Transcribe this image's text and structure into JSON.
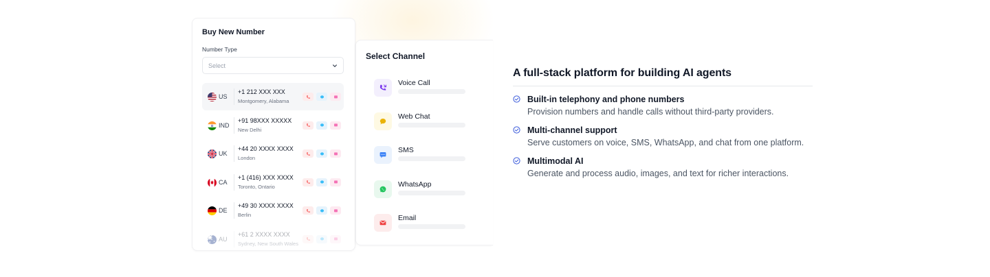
{
  "buy_card": {
    "title": "Buy New Number",
    "number_type_label": "Number Type",
    "select_placeholder": "Select",
    "numbers": [
      {
        "code": "US",
        "number": "+1 212 XXX XXX",
        "location": "Montgomery, Alabama",
        "flag": "us-flag-icon"
      },
      {
        "code": "IND",
        "number": "+91 98XXX XXXXX",
        "location": "New Delhi",
        "flag": "india-flag-icon"
      },
      {
        "code": "UK",
        "number": "+44 20 XXXX XXXX",
        "location": "London",
        "flag": "uk-flag-icon"
      },
      {
        "code": "CA",
        "number": "+1 (416) XXX XXXX",
        "location": "Toronto, Ontario",
        "flag": "canada-flag-icon"
      },
      {
        "code": "DE",
        "number": "+49 30 XXXX XXXX",
        "location": "Berlin",
        "flag": "germany-flag-icon"
      },
      {
        "code": "AU",
        "number": "+61 2 XXXX XXXX",
        "location": "Sydney, New South Wales",
        "flag": "australia-flag-icon"
      }
    ]
  },
  "channel_card": {
    "title": "Select Channel",
    "channels": [
      {
        "name": "Voice Call",
        "icon": "phone-call-icon",
        "color": "#7c3aed",
        "bg": "#f3effd"
      },
      {
        "name": "Web Chat",
        "icon": "chat-bubble-icon",
        "color": "#eab308",
        "bg": "#fef9e3"
      },
      {
        "name": "SMS",
        "icon": "sms-icon",
        "color": "#3b82f6",
        "bg": "#eaf2fd"
      },
      {
        "name": "WhatsApp",
        "icon": "whatsapp-icon",
        "color": "#22c55e",
        "bg": "#e8f8ee"
      },
      {
        "name": "Email",
        "icon": "email-icon",
        "color": "#ef4444",
        "bg": "#fdecec"
      }
    ]
  },
  "info": {
    "title": "A full-stack platform for building AI agents",
    "features": [
      {
        "title": "Built-in telephony and phone numbers",
        "description": "Provision numbers and handle calls without third-party providers."
      },
      {
        "title": "Multi-channel support",
        "description": "Serve customers on voice, SMS, WhatsApp, and chat from one platform."
      },
      {
        "title": "Multimodal AI",
        "description": "Generate and process audio, images, and text for richer interactions."
      }
    ]
  },
  "colors": {
    "check": "#3b5bdb",
    "call_action": "#f87171",
    "chat_action": "#38bdf8",
    "msg_action": "#f472b6"
  }
}
